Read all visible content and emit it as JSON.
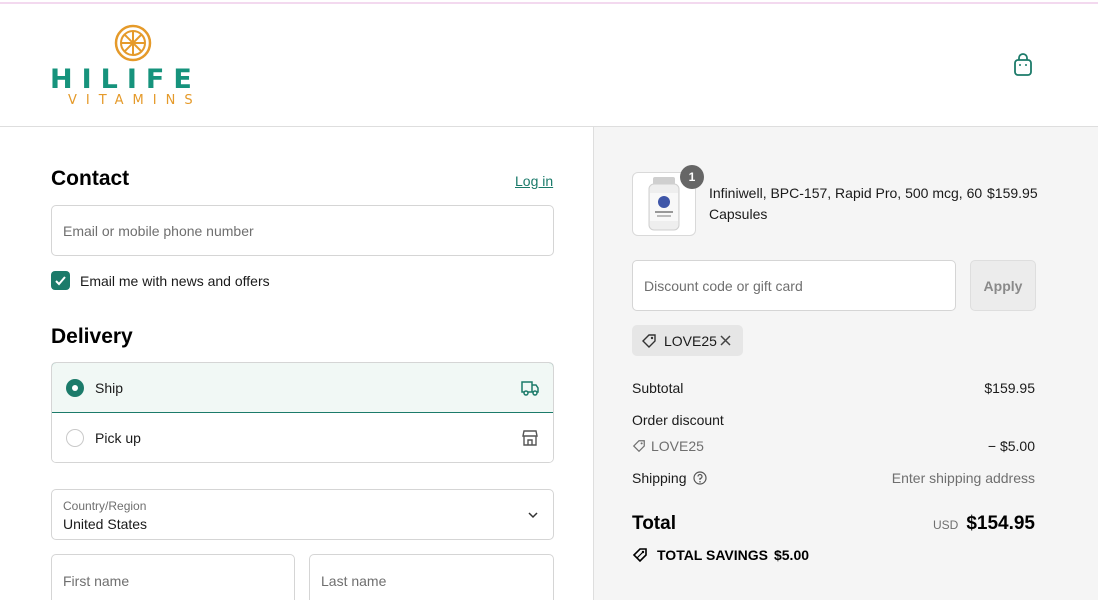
{
  "brand": {
    "name": "HILIFE",
    "sub": "VITAMINS"
  },
  "colors": {
    "accent": "#1c7b6a",
    "logo_green": "#16937c",
    "logo_orange": "#e59a2a"
  },
  "contact": {
    "heading": "Contact",
    "login_link": "Log in",
    "email_placeholder": "Email or mobile phone number",
    "newsletter_label": "Email me with news and offers",
    "newsletter_checked": true
  },
  "delivery": {
    "heading": "Delivery",
    "options": [
      {
        "label": "Ship",
        "selected": true,
        "icon": "truck-icon"
      },
      {
        "label": "Pick up",
        "selected": false,
        "icon": "store-icon"
      }
    ],
    "country_label": "Country/Region",
    "country_value": "United States",
    "first_name_placeholder": "First name",
    "last_name_placeholder": "Last name"
  },
  "summary": {
    "item": {
      "quantity": "1",
      "name": "Infiniwell, BPC-157, Rapid Pro, 500 mcg, 60 Capsules",
      "price": "$159.95"
    },
    "discount_placeholder": "Discount code or gift card",
    "apply_label": "Apply",
    "applied_code": "LOVE25",
    "subtotal_label": "Subtotal",
    "subtotal_value": "$159.95",
    "order_discount_label": "Order discount",
    "discount_code": "LOVE25",
    "discount_value": "− $5.00",
    "shipping_label": "Shipping",
    "shipping_value": "Enter shipping address",
    "total_label": "Total",
    "total_currency": "USD",
    "total_value": "$154.95",
    "savings_label": "TOTAL SAVINGS",
    "savings_value": "$5.00"
  }
}
